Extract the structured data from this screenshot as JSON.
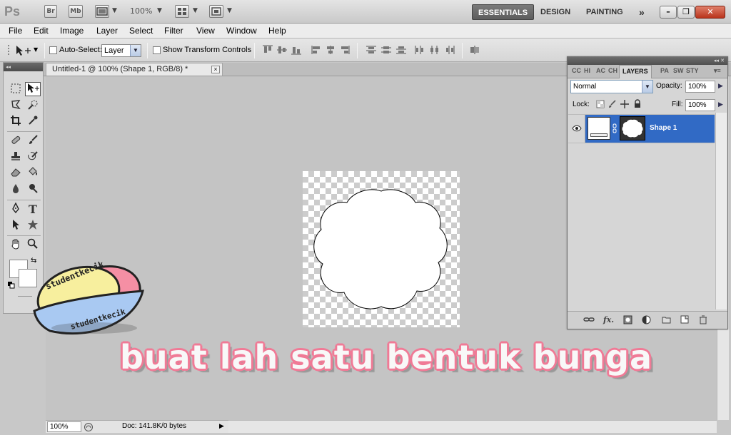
{
  "appbar": {
    "logo": "Ps",
    "bridge_label": "Br",
    "minibridge_label": "Mb",
    "zoom": "100%",
    "workspaces": [
      "ESSENTIALS",
      "DESIGN",
      "PAINTING"
    ],
    "more_label": "»",
    "window_controls": [
      "–",
      "❐",
      "✕"
    ]
  },
  "menu": [
    "File",
    "Edit",
    "Image",
    "Layer",
    "Select",
    "Filter",
    "View",
    "Window",
    "Help"
  ],
  "options": {
    "auto_select_label": "Auto-Select:",
    "auto_select_value": "Layer",
    "show_transform_label": "Show Transform Controls"
  },
  "document": {
    "tab_title": "Untitled-1 @ 100% (Shape 1, RGB/8) *",
    "close_label": "×"
  },
  "status": {
    "zoom": "100%",
    "info": "Doc: 141.8K/0 bytes",
    "arrow": "▶"
  },
  "layers_panel": {
    "tabs": [
      "CC",
      "HI",
      "AC",
      "CH",
      "LAYERS",
      "PA",
      "SW",
      "STY"
    ],
    "active_tab": "LAYERS",
    "blend_mode": "Normal",
    "opacity_label": "Opacity:",
    "opacity_value": "100%",
    "lock_label": "Lock:",
    "fill_label": "Fill:",
    "fill_value": "100%",
    "layers": [
      {
        "name": "Shape 1",
        "visible": true,
        "selected": true
      }
    ]
  },
  "overlay": {
    "caption": "buat lah satu bentuk bunga",
    "logo_text": "studentkecik",
    "logo_text_2": "studentkecik"
  },
  "colors": {
    "selection_blue": "#316ac5",
    "caption_pink": "#f07a96",
    "checker_gray": "#cccccc"
  }
}
